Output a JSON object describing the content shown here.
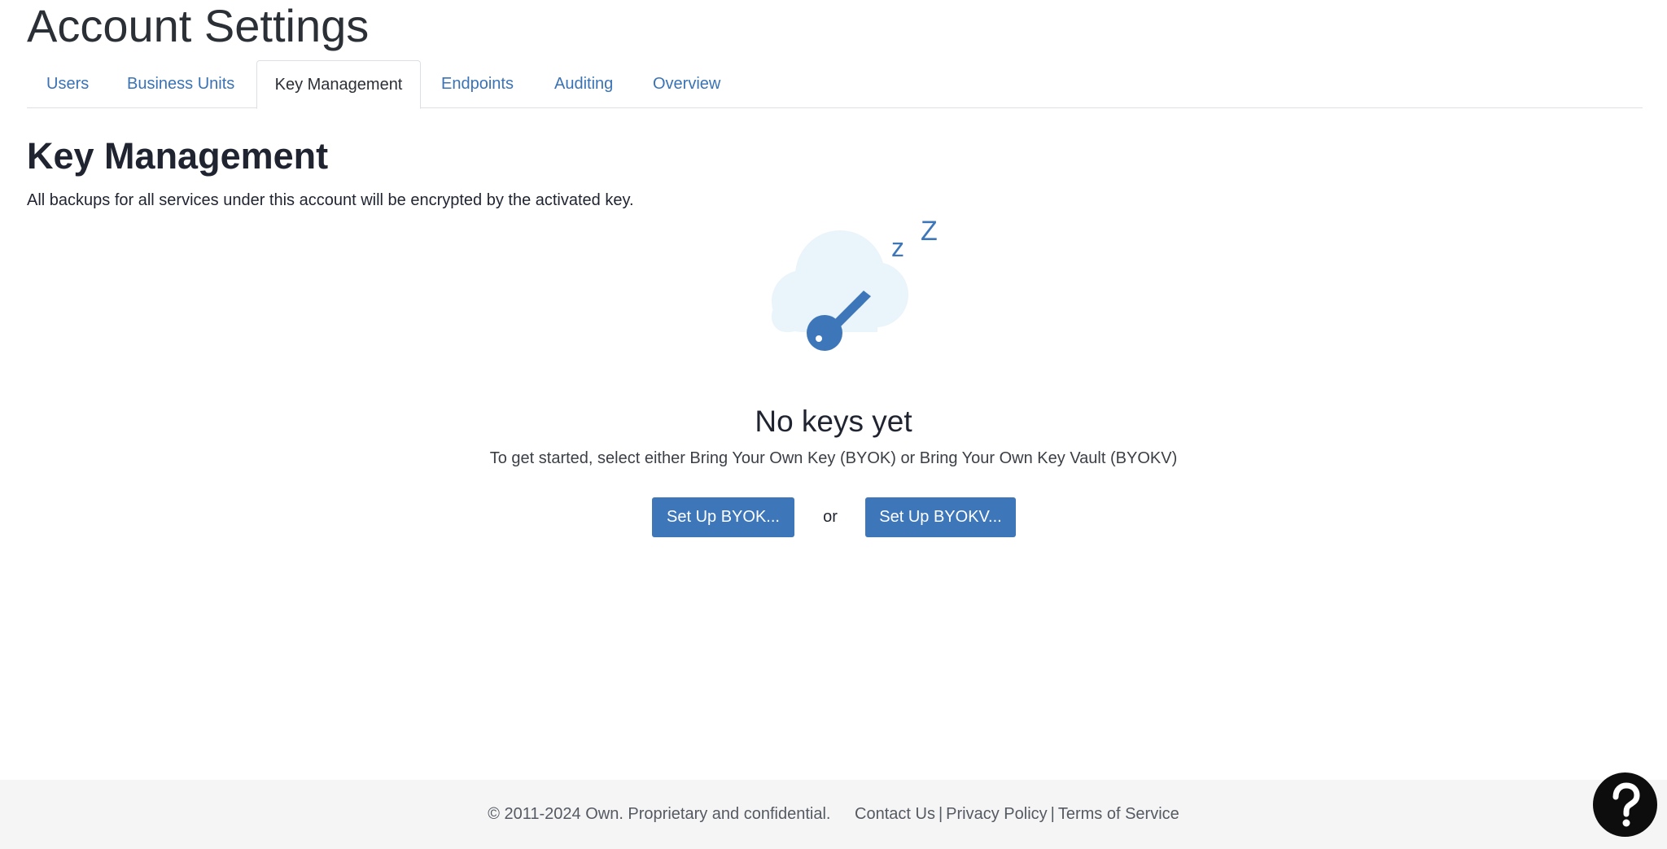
{
  "header": {
    "title": "Account Settings"
  },
  "tabs": [
    {
      "label": "Users"
    },
    {
      "label": "Business Units"
    },
    {
      "label": "Key Management",
      "active": true
    },
    {
      "label": "Endpoints"
    },
    {
      "label": "Auditing"
    },
    {
      "label": "Overview"
    }
  ],
  "main": {
    "title": "Key Management",
    "description": "All backups for all services under this account will be encrypted by the activated key.",
    "illustration": {
      "icon": "sleeping-key-cloud-icon",
      "z_small": "z",
      "z_large": "Z"
    },
    "empty_state": {
      "title": "No keys yet",
      "description": "To get started, select either Bring Your Own Key (BYOK) or Bring Your Own Key Vault (BYOKV)",
      "byok_button": "Set Up BYOK...",
      "or_label": "or",
      "byokv_button": "Set Up BYOKV..."
    }
  },
  "footer": {
    "copyright": "© 2011-2024 Own. Proprietary and confidential.",
    "links": [
      "Contact Us",
      "Privacy Policy",
      "Terms of Service"
    ],
    "separator": "|"
  },
  "help": {
    "icon": "question-mark-icon"
  },
  "colors": {
    "accent": "#3d77ba",
    "link": "#3a73b5",
    "cloud": "#eaf4fb",
    "footer_bg": "#f5f5f5",
    "help_bg": "#0d0d0d"
  }
}
